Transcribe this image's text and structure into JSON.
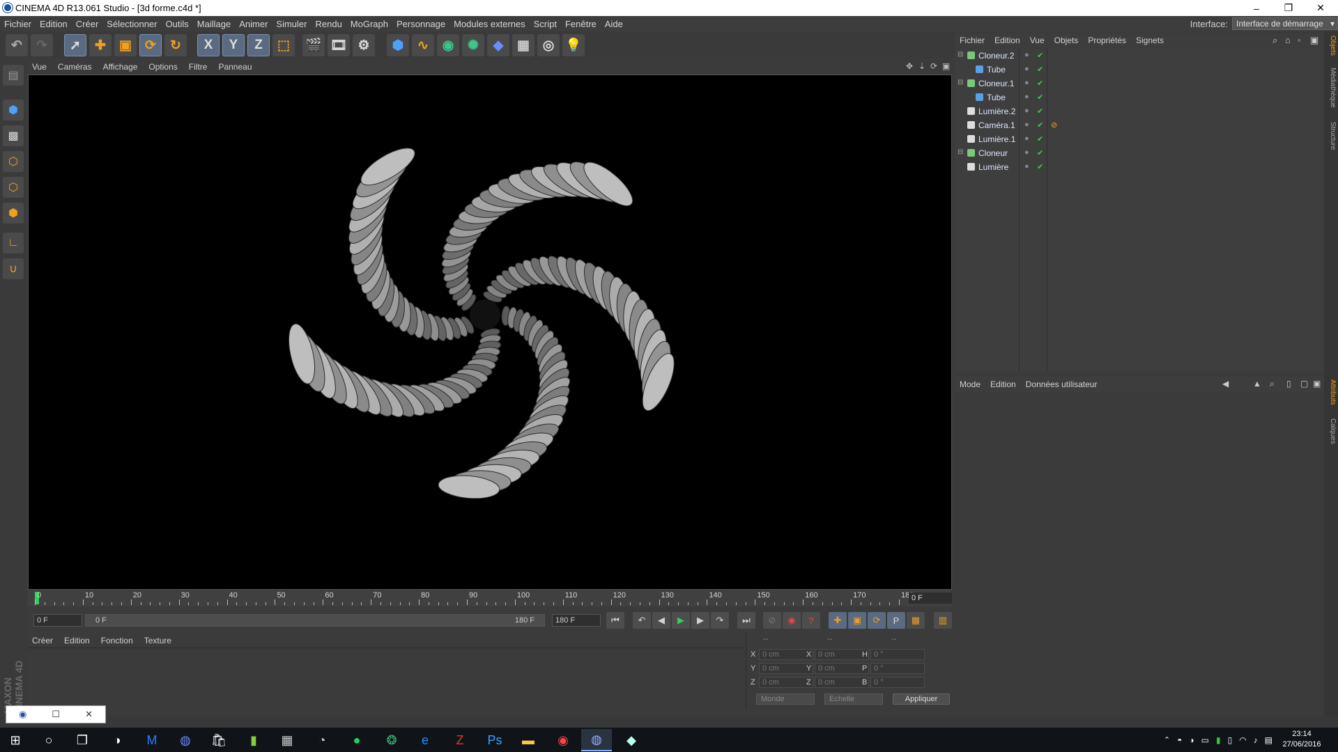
{
  "window": {
    "title": "CINEMA 4D R13.061 Studio - [3d forme.c4d *]",
    "minimize": "–",
    "maximize": "❐",
    "close": "✕"
  },
  "menu": [
    "Fichier",
    "Edition",
    "Créer",
    "Sélectionner",
    "Outils",
    "Maillage",
    "Animer",
    "Simuler",
    "Rendu",
    "MoGraph",
    "Personnage",
    "Modules externes",
    "Script",
    "Fenêtre",
    "Aide"
  ],
  "interface": {
    "label": "Interface:",
    "value": "Interface de démarrage"
  },
  "toolbar": {
    "undo_icon": "undo-icon",
    "redo_icon": "redo-icon",
    "select_icon": "cursor-icon",
    "move_icon": "move-icon",
    "scale_icon": "scale-icon",
    "rotate_icon": "rotate-icon",
    "axis_x": "X",
    "axis_y": "Y",
    "axis_z": "Z",
    "coord_icon": "coordinate-system-icon",
    "render_view_icon": "render-view-icon",
    "render_pv_icon": "render-picture-viewer-icon",
    "render_settings_icon": "render-settings-icon",
    "cube_icon": "cube-primitive-icon",
    "spline_icon": "spline-icon",
    "nurbs_icon": "nurbs-icon",
    "array_icon": "array-icon",
    "deformer_icon": "deformer-icon",
    "floor_icon": "floor-icon",
    "camera_icon": "camera-icon",
    "light_icon": "light-icon"
  },
  "viewport": {
    "menu": [
      "Vue",
      "Caméras",
      "Affichage",
      "Options",
      "Filtre",
      "Panneau"
    ]
  },
  "timeline": {
    "ticks": [
      "0",
      "10",
      "20",
      "30",
      "40",
      "50",
      "60",
      "70",
      "80",
      "90",
      "100",
      "110",
      "120",
      "130",
      "140",
      "150",
      "160",
      "170",
      "180"
    ],
    "current_frame": "0 F",
    "start_field": "0 F",
    "range_start": "0 F",
    "range_end": "180 F",
    "end_field": "180 F"
  },
  "materials": {
    "menu": [
      "Créer",
      "Edition",
      "Fonction",
      "Texture"
    ]
  },
  "coords": {
    "header": [
      "--",
      "--",
      "--"
    ],
    "rows": [
      [
        "X",
        "0 cm",
        "X",
        "0 cm",
        "H",
        "0 °"
      ],
      [
        "Y",
        "0 cm",
        "Y",
        "0 cm",
        "P",
        "0 °"
      ],
      [
        "Z",
        "0 cm",
        "Z",
        "0 cm",
        "B",
        "0 °"
      ]
    ],
    "world": "Monde",
    "scale": "Echelle",
    "apply": "Appliquer"
  },
  "objects": {
    "menu": [
      "Fichier",
      "Edition",
      "Vue",
      "Objets",
      "Propriétés",
      "Signets"
    ],
    "items": [
      {
        "name": "Cloneur.2",
        "indent": 0,
        "color": "#7ac87a"
      },
      {
        "name": "Tube",
        "indent": 1,
        "color": "#5aa0e6"
      },
      {
        "name": "Cloneur.1",
        "indent": 0,
        "color": "#7ac87a"
      },
      {
        "name": "Tube",
        "indent": 1,
        "color": "#5aa0e6"
      },
      {
        "name": "Lumière.2",
        "indent": 0,
        "color": "#dddddd"
      },
      {
        "name": "Caméra.1",
        "indent": 0,
        "color": "#dddddd"
      },
      {
        "name": "Lumière.1",
        "indent": 0,
        "color": "#dddddd"
      },
      {
        "name": "Cloneur",
        "indent": 0,
        "color": "#7ac87a"
      },
      {
        "name": "Lumière",
        "indent": 0,
        "color": "#dddddd"
      }
    ]
  },
  "attributes": {
    "menu": [
      "Mode",
      "Edition",
      "Données utilisateur"
    ]
  },
  "right_tabs": [
    "Objets",
    "Médiathèque",
    "Structure",
    "Attributs",
    "Calques"
  ],
  "brand": "MAXON CINEMA 4D",
  "taskbar": {
    "time": "23:14",
    "date": "27/06/2016"
  },
  "colors": {
    "accent": "#f0a020",
    "viewport_bg": "#000000",
    "panel": "#3b3b3b"
  }
}
